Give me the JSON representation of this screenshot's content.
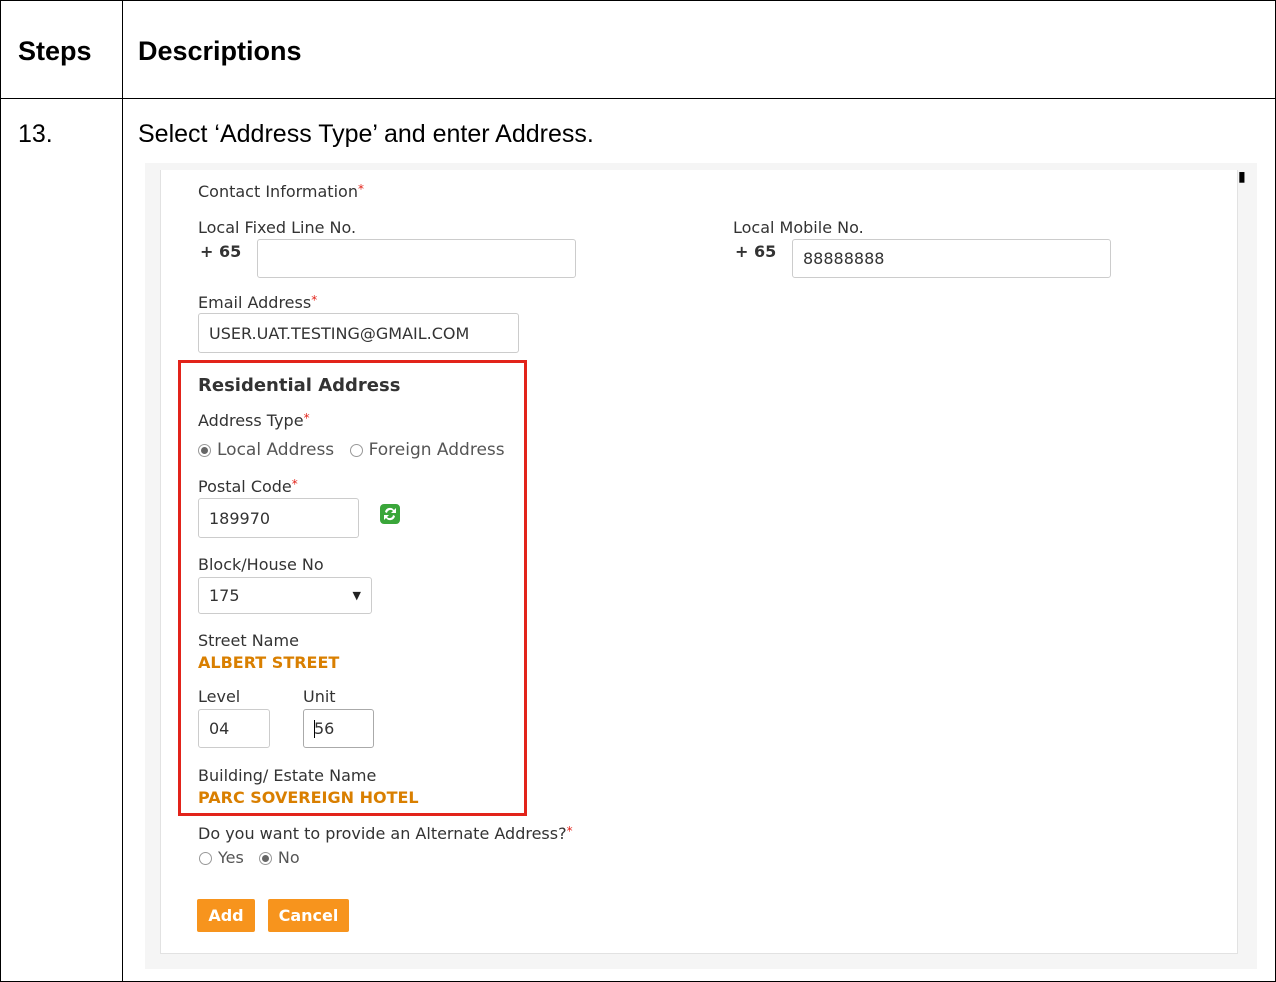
{
  "table": {
    "header_steps": "Steps",
    "header_descriptions": "Descriptions",
    "step_number": "13.",
    "step_description": "Select ‘Address Type’ and enter Address."
  },
  "form": {
    "contact_info_label": "Contact Information",
    "fixed_line_label": "Local Fixed Line No.",
    "fixed_line_prefix": "+ 65",
    "fixed_line_value": "",
    "mobile_label": "Local Mobile No.",
    "mobile_prefix": "+ 65",
    "mobile_value": "88888888",
    "email_label": "Email Address",
    "email_value": "USER.UAT.TESTING@GMAIL.COM",
    "residential_title": "Residential Address",
    "address_type_label": "Address Type",
    "address_type_local": "Local Address",
    "address_type_foreign": "Foreign Address",
    "postal_code_label": "Postal Code",
    "postal_code_value": "189970",
    "block_label": "Block/House No",
    "block_value": "175",
    "street_label": "Street Name",
    "street_value": "ALBERT STREET",
    "level_label": "Level",
    "level_value": "04",
    "unit_label": "Unit",
    "unit_value": "56",
    "building_label": "Building/ Estate Name",
    "building_value": "PARC SOVEREIGN HOTEL",
    "alternate_question": "Do you want to provide an Alternate Address?",
    "alt_yes": "Yes",
    "alt_no": "No",
    "add_button": "Add",
    "cancel_button": "Cancel"
  },
  "colors": {
    "accent": "#f7941d",
    "required": "#e2231a",
    "highlight_box": "#e2231a",
    "value_text": "#d97f00"
  }
}
